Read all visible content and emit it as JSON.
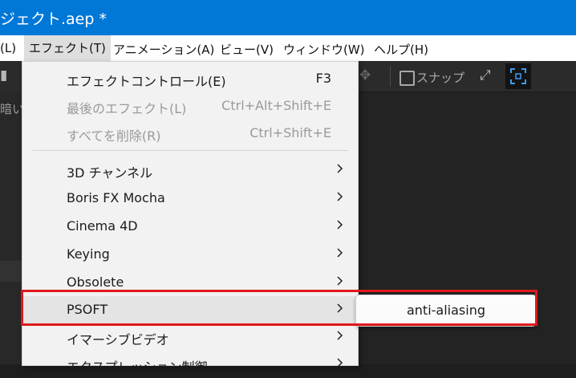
{
  "titlebar": {
    "title": "ジェクト.aep *",
    "bg": "#0078d7"
  },
  "menubar": {
    "items": [
      {
        "label": "(L)"
      },
      {
        "label": "エフェクト(T)"
      },
      {
        "label": "アニメーション(A)"
      },
      {
        "label": "ビュー(V)"
      },
      {
        "label": "ウィンドウ(W)"
      },
      {
        "label": "ヘルプ(H)"
      }
    ]
  },
  "toolbar": {
    "snap_label": "スナップ"
  },
  "left_panel": {
    "text": "暗い"
  },
  "menu": {
    "items": [
      {
        "label": "エフェクトコントロール(E)",
        "shortcut": "F3"
      },
      {
        "label": "最後のエフェクト(L)",
        "shortcut": "Ctrl+Alt+Shift+E"
      },
      {
        "label": "すべてを削除(R)",
        "shortcut": "Ctrl+Shift+E"
      },
      {
        "label": "3D チャンネル"
      },
      {
        "label": "Boris FX Mocha"
      },
      {
        "label": "Cinema 4D"
      },
      {
        "label": "Keying"
      },
      {
        "label": "Obsolete"
      },
      {
        "label": "PSOFT"
      },
      {
        "label": "イマーシブビデオ"
      },
      {
        "label": "エクスプレッション制御"
      }
    ]
  },
  "submenu": {
    "items": [
      {
        "label": "anti-aliasing"
      }
    ]
  },
  "colors": {
    "highlight_box": "#e0171c",
    "accent": "#0078d7"
  }
}
